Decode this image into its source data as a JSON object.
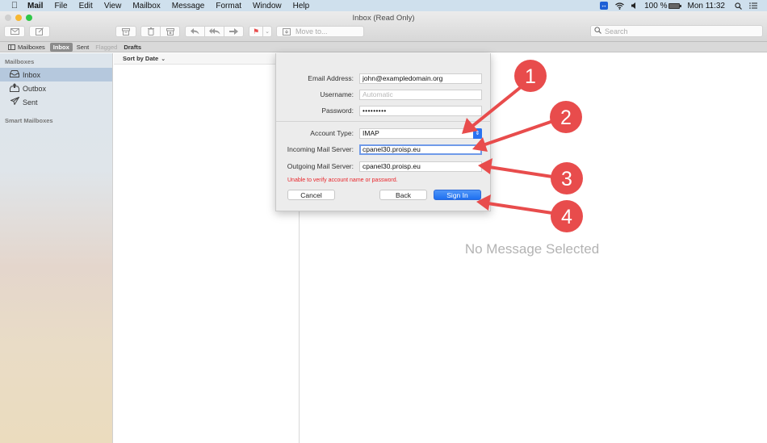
{
  "menubar": {
    "apple_icon": "apple-logo",
    "items": [
      "Mail",
      "File",
      "Edit",
      "View",
      "Mailbox",
      "Message",
      "Format",
      "Window",
      "Help"
    ],
    "status": {
      "battery": "100 %",
      "clock": "Mon 11:32"
    }
  },
  "window": {
    "title": "Inbox (Read Only)"
  },
  "toolbar": {
    "move_to_label": "Move to...",
    "search_placeholder": "Search"
  },
  "favorites": {
    "mailboxes": "Mailboxes",
    "inbox": "Inbox",
    "sent": "Sent",
    "flagged": "Flagged",
    "drafts": "Drafts"
  },
  "sidebar": {
    "heading": "Mailboxes",
    "items": [
      {
        "label": "Inbox",
        "icon": "inbox-tray-icon",
        "selected": true
      },
      {
        "label": "Outbox",
        "icon": "outbox-tray-icon",
        "selected": false
      },
      {
        "label": "Sent",
        "icon": "paper-plane-icon",
        "selected": false
      }
    ],
    "smart_heading": "Smart Mailboxes"
  },
  "message_list": {
    "sort_label": "Sort by Date"
  },
  "viewer": {
    "empty_text": "No Message Selected"
  },
  "sheet": {
    "email_label": "Email Address:",
    "email_value": "john@exampledomain.org",
    "username_label": "Username:",
    "username_placeholder": "Automatic",
    "password_label": "Password:",
    "password_value": "•••••••••",
    "account_type_label": "Account Type:",
    "account_type_value": "IMAP",
    "incoming_label": "Incoming Mail Server:",
    "incoming_value": "cpanel30.proisp.eu",
    "outgoing_label": "Outgoing Mail Server:",
    "outgoing_value": "cpanel30.proisp.eu",
    "error_text": "Unable to verify account name or password.",
    "cancel_label": "Cancel",
    "back_label": "Back",
    "signin_label": "Sign In"
  },
  "annotations": {
    "color": "#e84c4c",
    "markers": [
      "1",
      "2",
      "3",
      "4"
    ]
  }
}
